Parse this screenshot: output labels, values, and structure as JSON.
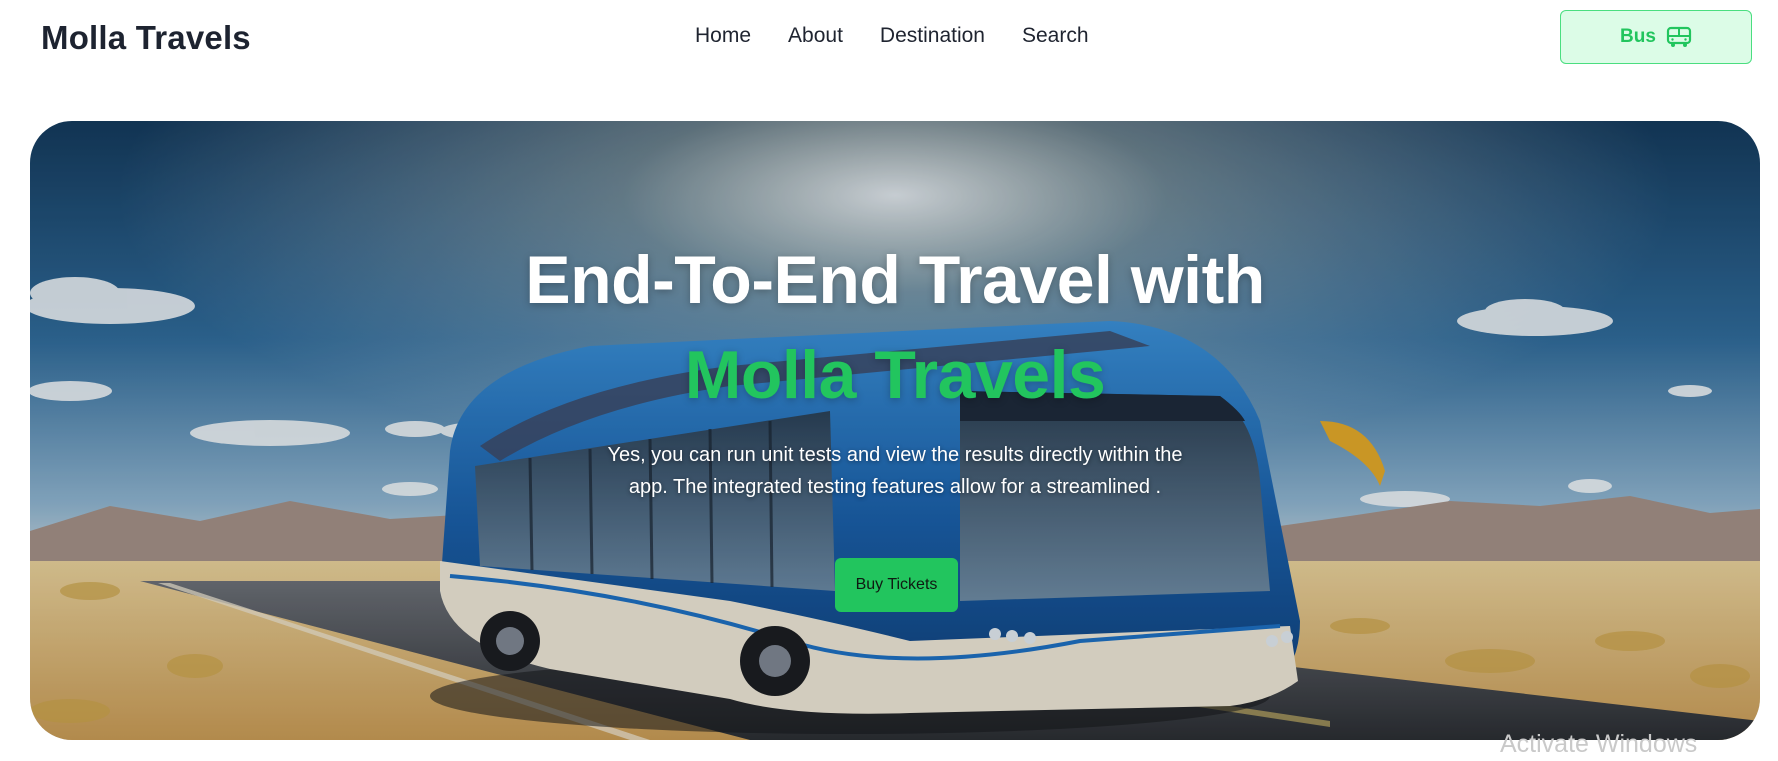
{
  "navbar": {
    "brand": "Molla Travels",
    "links": [
      "Home",
      "About",
      "Destination",
      "Search"
    ],
    "bus_button": {
      "label": "Bus",
      "icon": "bus-icon"
    }
  },
  "hero": {
    "title_line1": "End-To-End Travel with",
    "title_line2": "Molla Travels",
    "description": "Yes, you can run unit tests and view the results directly within the app. The integrated testing features allow for a streamlined .",
    "cta_label": "Buy Tickets"
  },
  "watermark": "Activate Windows",
  "colors": {
    "accent": "#22c55e",
    "accent_light": "#dcfce7",
    "text_dark": "#1d2330"
  }
}
